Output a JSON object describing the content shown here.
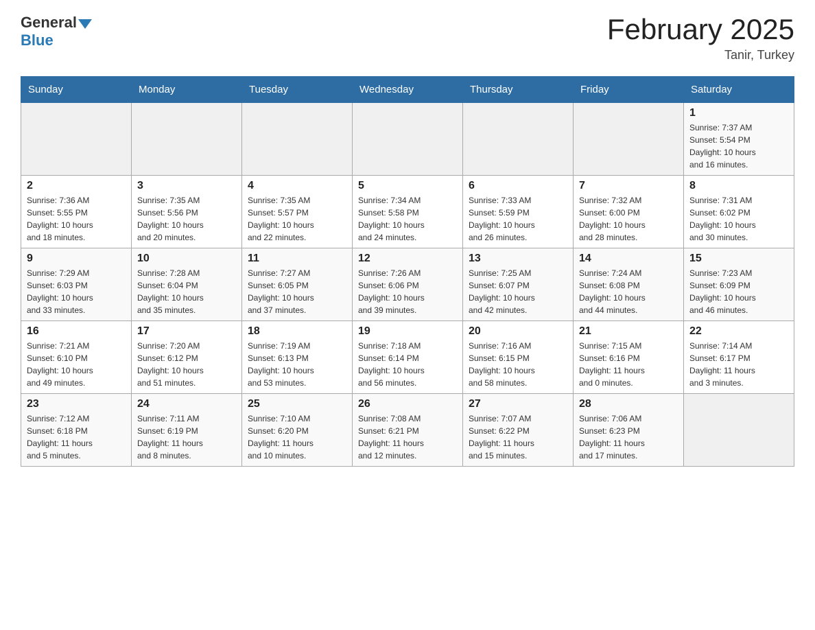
{
  "header": {
    "logo_general": "General",
    "logo_blue": "Blue",
    "month_year": "February 2025",
    "location": "Tanir, Turkey"
  },
  "days_of_week": [
    "Sunday",
    "Monday",
    "Tuesday",
    "Wednesday",
    "Thursday",
    "Friday",
    "Saturday"
  ],
  "weeks": [
    [
      {
        "day": "",
        "info": ""
      },
      {
        "day": "",
        "info": ""
      },
      {
        "day": "",
        "info": ""
      },
      {
        "day": "",
        "info": ""
      },
      {
        "day": "",
        "info": ""
      },
      {
        "day": "",
        "info": ""
      },
      {
        "day": "1",
        "info": "Sunrise: 7:37 AM\nSunset: 5:54 PM\nDaylight: 10 hours\nand 16 minutes."
      }
    ],
    [
      {
        "day": "2",
        "info": "Sunrise: 7:36 AM\nSunset: 5:55 PM\nDaylight: 10 hours\nand 18 minutes."
      },
      {
        "day": "3",
        "info": "Sunrise: 7:35 AM\nSunset: 5:56 PM\nDaylight: 10 hours\nand 20 minutes."
      },
      {
        "day": "4",
        "info": "Sunrise: 7:35 AM\nSunset: 5:57 PM\nDaylight: 10 hours\nand 22 minutes."
      },
      {
        "day": "5",
        "info": "Sunrise: 7:34 AM\nSunset: 5:58 PM\nDaylight: 10 hours\nand 24 minutes."
      },
      {
        "day": "6",
        "info": "Sunrise: 7:33 AM\nSunset: 5:59 PM\nDaylight: 10 hours\nand 26 minutes."
      },
      {
        "day": "7",
        "info": "Sunrise: 7:32 AM\nSunset: 6:00 PM\nDaylight: 10 hours\nand 28 minutes."
      },
      {
        "day": "8",
        "info": "Sunrise: 7:31 AM\nSunset: 6:02 PM\nDaylight: 10 hours\nand 30 minutes."
      }
    ],
    [
      {
        "day": "9",
        "info": "Sunrise: 7:29 AM\nSunset: 6:03 PM\nDaylight: 10 hours\nand 33 minutes."
      },
      {
        "day": "10",
        "info": "Sunrise: 7:28 AM\nSunset: 6:04 PM\nDaylight: 10 hours\nand 35 minutes."
      },
      {
        "day": "11",
        "info": "Sunrise: 7:27 AM\nSunset: 6:05 PM\nDaylight: 10 hours\nand 37 minutes."
      },
      {
        "day": "12",
        "info": "Sunrise: 7:26 AM\nSunset: 6:06 PM\nDaylight: 10 hours\nand 39 minutes."
      },
      {
        "day": "13",
        "info": "Sunrise: 7:25 AM\nSunset: 6:07 PM\nDaylight: 10 hours\nand 42 minutes."
      },
      {
        "day": "14",
        "info": "Sunrise: 7:24 AM\nSunset: 6:08 PM\nDaylight: 10 hours\nand 44 minutes."
      },
      {
        "day": "15",
        "info": "Sunrise: 7:23 AM\nSunset: 6:09 PM\nDaylight: 10 hours\nand 46 minutes."
      }
    ],
    [
      {
        "day": "16",
        "info": "Sunrise: 7:21 AM\nSunset: 6:10 PM\nDaylight: 10 hours\nand 49 minutes."
      },
      {
        "day": "17",
        "info": "Sunrise: 7:20 AM\nSunset: 6:12 PM\nDaylight: 10 hours\nand 51 minutes."
      },
      {
        "day": "18",
        "info": "Sunrise: 7:19 AM\nSunset: 6:13 PM\nDaylight: 10 hours\nand 53 minutes."
      },
      {
        "day": "19",
        "info": "Sunrise: 7:18 AM\nSunset: 6:14 PM\nDaylight: 10 hours\nand 56 minutes."
      },
      {
        "day": "20",
        "info": "Sunrise: 7:16 AM\nSunset: 6:15 PM\nDaylight: 10 hours\nand 58 minutes."
      },
      {
        "day": "21",
        "info": "Sunrise: 7:15 AM\nSunset: 6:16 PM\nDaylight: 11 hours\nand 0 minutes."
      },
      {
        "day": "22",
        "info": "Sunrise: 7:14 AM\nSunset: 6:17 PM\nDaylight: 11 hours\nand 3 minutes."
      }
    ],
    [
      {
        "day": "23",
        "info": "Sunrise: 7:12 AM\nSunset: 6:18 PM\nDaylight: 11 hours\nand 5 minutes."
      },
      {
        "day": "24",
        "info": "Sunrise: 7:11 AM\nSunset: 6:19 PM\nDaylight: 11 hours\nand 8 minutes."
      },
      {
        "day": "25",
        "info": "Sunrise: 7:10 AM\nSunset: 6:20 PM\nDaylight: 11 hours\nand 10 minutes."
      },
      {
        "day": "26",
        "info": "Sunrise: 7:08 AM\nSunset: 6:21 PM\nDaylight: 11 hours\nand 12 minutes."
      },
      {
        "day": "27",
        "info": "Sunrise: 7:07 AM\nSunset: 6:22 PM\nDaylight: 11 hours\nand 15 minutes."
      },
      {
        "day": "28",
        "info": "Sunrise: 7:06 AM\nSunset: 6:23 PM\nDaylight: 11 hours\nand 17 minutes."
      },
      {
        "day": "",
        "info": ""
      }
    ]
  ]
}
